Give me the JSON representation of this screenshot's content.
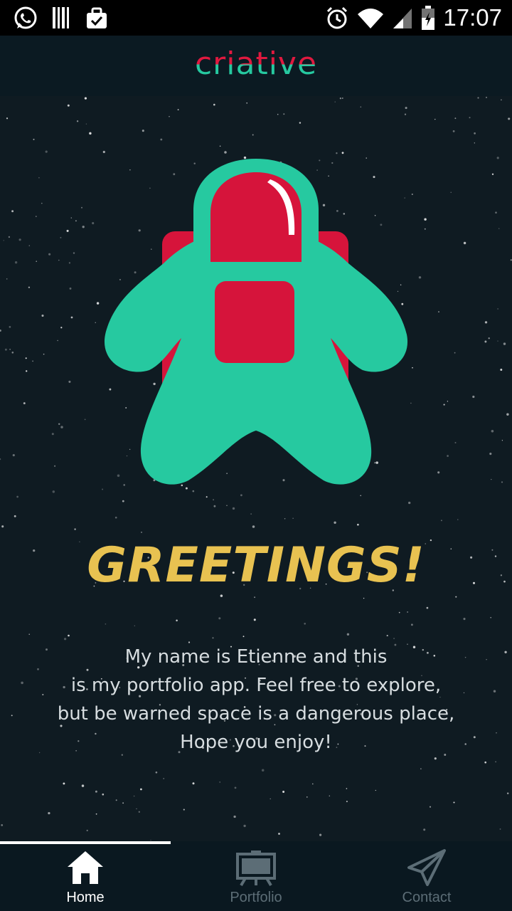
{
  "status_bar": {
    "time": "17:07",
    "icons": [
      "whatsapp-icon",
      "barcode-icon",
      "briefcase-icon",
      "alarm-icon",
      "wifi-icon",
      "signal-icon",
      "battery-icon"
    ]
  },
  "header": {
    "logo_text": "criative",
    "logo_colors": {
      "top": "#e0193f",
      "bottom": "#26c9a0"
    }
  },
  "hero": {
    "illustration": "astronaut-illustration",
    "title": "GREETINGS!",
    "intro_lines": [
      "My name is Etienne and this",
      "is my portfolio app. Feel free to explore,",
      "but be warned space is a dangerous place,",
      "Hope you enjoy!"
    ]
  },
  "tabs": [
    {
      "label": "Home",
      "icon": "home-icon",
      "active": true
    },
    {
      "label": "Portfolio",
      "icon": "easel-icon",
      "active": false
    },
    {
      "label": "Contact",
      "icon": "paper-plane-icon",
      "active": false
    }
  ],
  "colors": {
    "background": "#0f1b22",
    "accent_teal": "#26c9a0",
    "accent_red": "#d6143b",
    "title_yellow": "#e8c251"
  }
}
